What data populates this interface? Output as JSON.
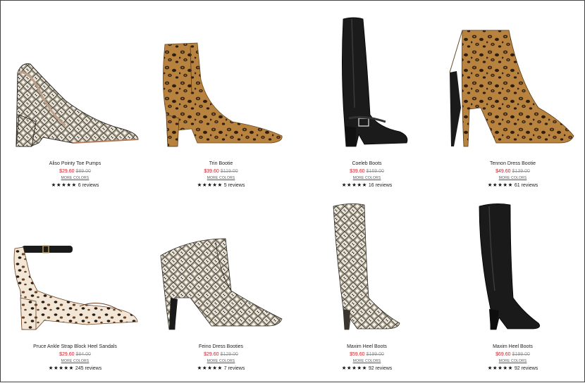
{
  "products": [
    {
      "name": "Aliso Pointy Toe Pumps",
      "sale_price": "$29.60",
      "original_price": "$89.00",
      "more_colors": "MORE COLORS",
      "stars": "★★★★★",
      "reviews": "6 reviews",
      "image": "snakeskin-pump-icon"
    },
    {
      "name": "Trin Bootie",
      "sale_price": "$39.60",
      "original_price": "$119.00",
      "more_colors": "MORE COLORS",
      "stars": "★★★★★",
      "reviews": "5 reviews",
      "image": "leopard-bootie-icon"
    },
    {
      "name": "Coeleb Boots",
      "sale_price": "$39.60",
      "original_price": "$169.00",
      "more_colors": "MORE COLORS",
      "stars": "★★★★★",
      "reviews": "16 reviews",
      "image": "black-tall-boot-icon"
    },
    {
      "name": "Tennon Dress Bootie",
      "sale_price": "$49.60",
      "original_price": "$139.00",
      "more_colors": "MORE COLORS",
      "stars": "★★★★★",
      "reviews": "61 reviews",
      "image": "leopard-stiletto-bootie-icon"
    },
    {
      "name": "Pruce Ankle Strap Block Heel Sandals",
      "sale_price": "$29.60",
      "original_price": "$84.00",
      "more_colors": "MORE COLORS",
      "stars": "★★★★★",
      "reviews": "245 reviews",
      "image": "leopard-sandal-icon"
    },
    {
      "name": "Feino Dress Booties",
      "sale_price": "$29.60",
      "original_price": "$129.00",
      "more_colors": "MORE COLORS",
      "stars": "★★★★★",
      "reviews": "7 reviews",
      "image": "snakeskin-bootie-icon"
    },
    {
      "name": "Maxim Heel Boots",
      "sale_price": "$59.60",
      "original_price": "$199.00",
      "more_colors": "MORE COLORS",
      "stars": "★★★★★",
      "reviews": "92 reviews",
      "image": "snakeskin-tall-boot-icon"
    },
    {
      "name": "Maxim Heel Boots",
      "sale_price": "$69.60",
      "original_price": "$199.00",
      "more_colors": "MORE COLORS",
      "stars": "★★★★★",
      "reviews": "92 reviews",
      "image": "black-heel-boot-icon"
    }
  ],
  "colors": {
    "sale": "#c8202a",
    "original": "#999999",
    "stars": "#111111"
  }
}
